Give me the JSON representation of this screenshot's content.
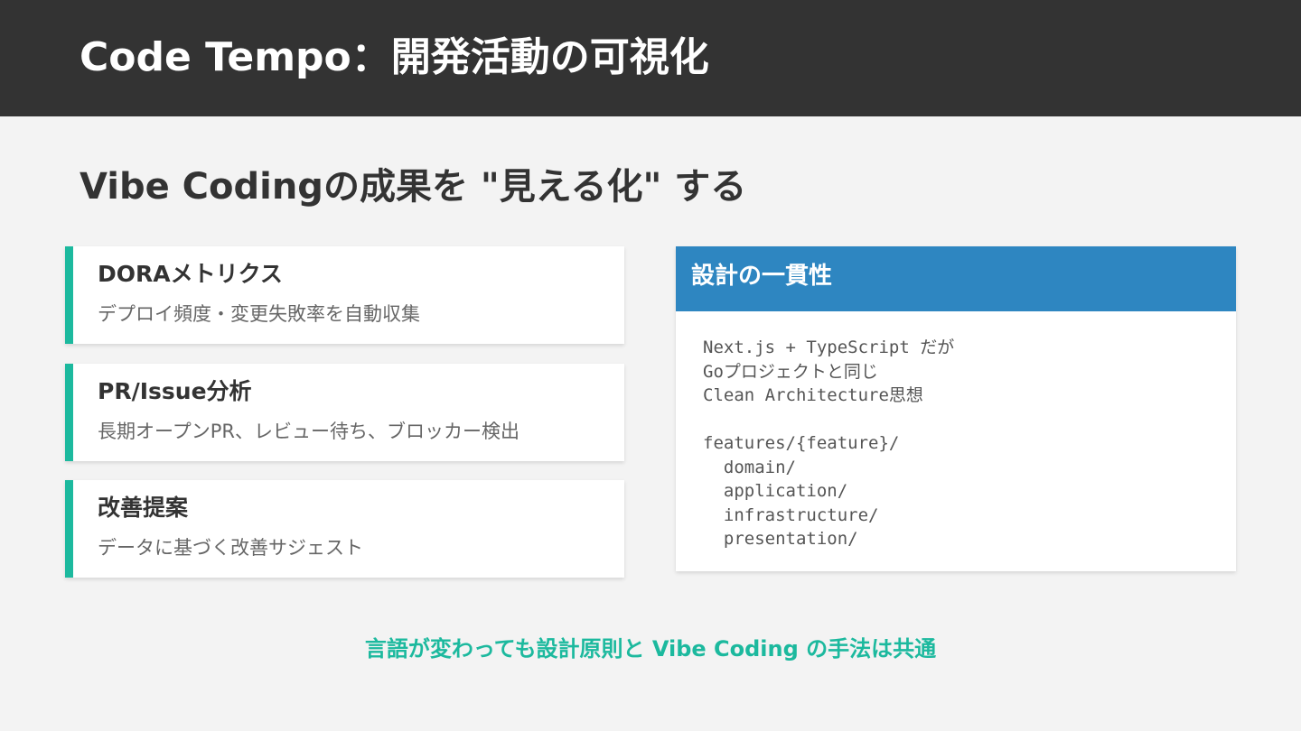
{
  "header": {
    "title": "Code Tempo：開発活動の可視化"
  },
  "subtitle": "Vibe Codingの成果を \"見える化\" する",
  "cards": [
    {
      "title": "DORAメトリクス",
      "description": "デプロイ頻度・変更失敗率を自動収集"
    },
    {
      "title": "PR/Issue分析",
      "description": "長期オープンPR、レビュー待ち、ブロッカー検出"
    },
    {
      "title": "改善提案",
      "description": "データに基づく改善サジェスト"
    }
  ],
  "design_panel": {
    "title": "設計の一貫性",
    "code_lines": [
      "Next.js + TypeScript だが",
      "Goプロジェクトと同じ",
      "Clean Architecture思想",
      "",
      "features/{feature}/",
      "  domain/",
      "  application/",
      "  infrastructure/",
      "  presentation/"
    ]
  },
  "footer_note": "言語が変わっても設計原則と Vibe Coding の手法は共通",
  "colors": {
    "header_bg": "#333333",
    "page_bg": "#f3f3f3",
    "accent_teal": "#1cb99e",
    "panel_blue": "#2e86c1"
  }
}
